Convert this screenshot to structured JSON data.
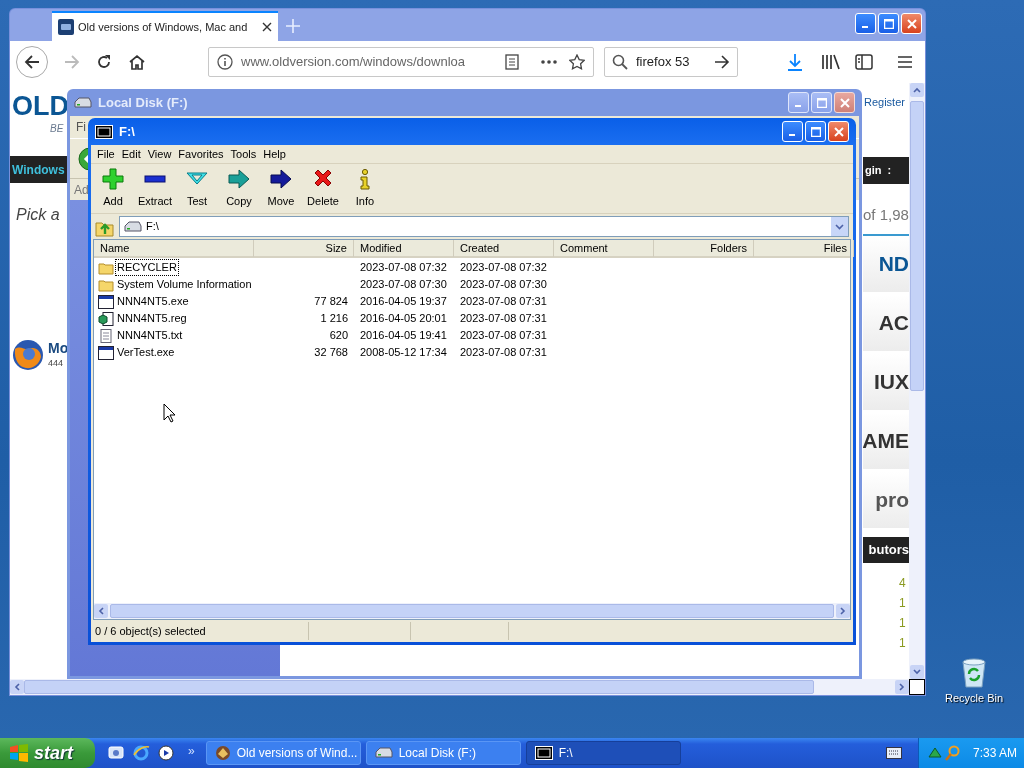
{
  "browser": {
    "tab": {
      "title": "Old versions of Windows, Mac and",
      "selected": true
    },
    "url": "www.oldversion.com/windows/downloa",
    "search": "firefox 53"
  },
  "website": {
    "left": {
      "logo": "OLD",
      "tagline": "BE",
      "nav": "Windows",
      "heading": "Pick a",
      "app_name": "Mo",
      "app_count": "444"
    },
    "right": {
      "register": "Register",
      "nav": "gin  :",
      "count": "of 1,98",
      "tiles": [
        "ND",
        "AC",
        "IUX",
        "AME",
        "pro"
      ],
      "section": "butors",
      "numbers": [
        "4",
        "1",
        "1",
        "1"
      ]
    }
  },
  "explorer_window": {
    "title": "Local Disk (F:)",
    "menu_fragment": "Fi",
    "address_fragment": "Ad"
  },
  "archiver_window": {
    "title": "F:\\",
    "menu": [
      "File",
      "Edit",
      "View",
      "Favorites",
      "Tools",
      "Help"
    ],
    "toolbar": [
      {
        "label": "Add",
        "kind": "add"
      },
      {
        "label": "Extract",
        "kind": "extract"
      },
      {
        "label": "Test",
        "kind": "test"
      },
      {
        "label": "Copy",
        "kind": "copy"
      },
      {
        "label": "Move",
        "kind": "move"
      },
      {
        "label": "Delete",
        "kind": "delete"
      },
      {
        "label": "Info",
        "kind": "info"
      }
    ],
    "path": "F:\\",
    "columns": [
      "Name",
      "Size",
      "Modified",
      "Created",
      "Comment",
      "Folders",
      "Files"
    ],
    "rows": [
      {
        "name": "RECYCLER",
        "kind": "folder",
        "size": "",
        "modified": "2023-07-08 07:32",
        "created": "2023-07-08 07:32",
        "focused": true
      },
      {
        "name": "System Volume Information",
        "kind": "folder",
        "size": "",
        "modified": "2023-07-08 07:30",
        "created": "2023-07-08 07:30",
        "focused": false
      },
      {
        "name": "NNN4NT5.exe",
        "kind": "exe",
        "size": "77 824",
        "modified": "2016-04-05 19:37",
        "created": "2023-07-08 07:31",
        "focused": false
      },
      {
        "name": "NNN4NT5.reg",
        "kind": "reg",
        "size": "1 216",
        "modified": "2016-04-05 20:01",
        "created": "2023-07-08 07:31",
        "focused": false
      },
      {
        "name": "NNN4NT5.txt",
        "kind": "txt",
        "size": "620",
        "modified": "2016-04-05 19:41",
        "created": "2023-07-08 07:31",
        "focused": false
      },
      {
        "name": "VerTest.exe",
        "kind": "exe",
        "size": "32 768",
        "modified": "2008-05-12 17:34",
        "created": "2023-07-08 07:31",
        "focused": false
      }
    ],
    "status": "0 / 6 object(s) selected"
  },
  "desktop_icons": [
    {
      "label": "Recycle Bin"
    }
  ],
  "taskbar": {
    "start": "start",
    "more": "»",
    "tasks": [
      {
        "label": "Old versions of Wind...",
        "kind": "browser",
        "selected": false
      },
      {
        "label": "Local Disk (F:)",
        "kind": "drive",
        "selected": false
      },
      {
        "label": "F:\\",
        "kind": "archiver",
        "selected": true
      }
    ],
    "clock": "7:33 AM"
  }
}
